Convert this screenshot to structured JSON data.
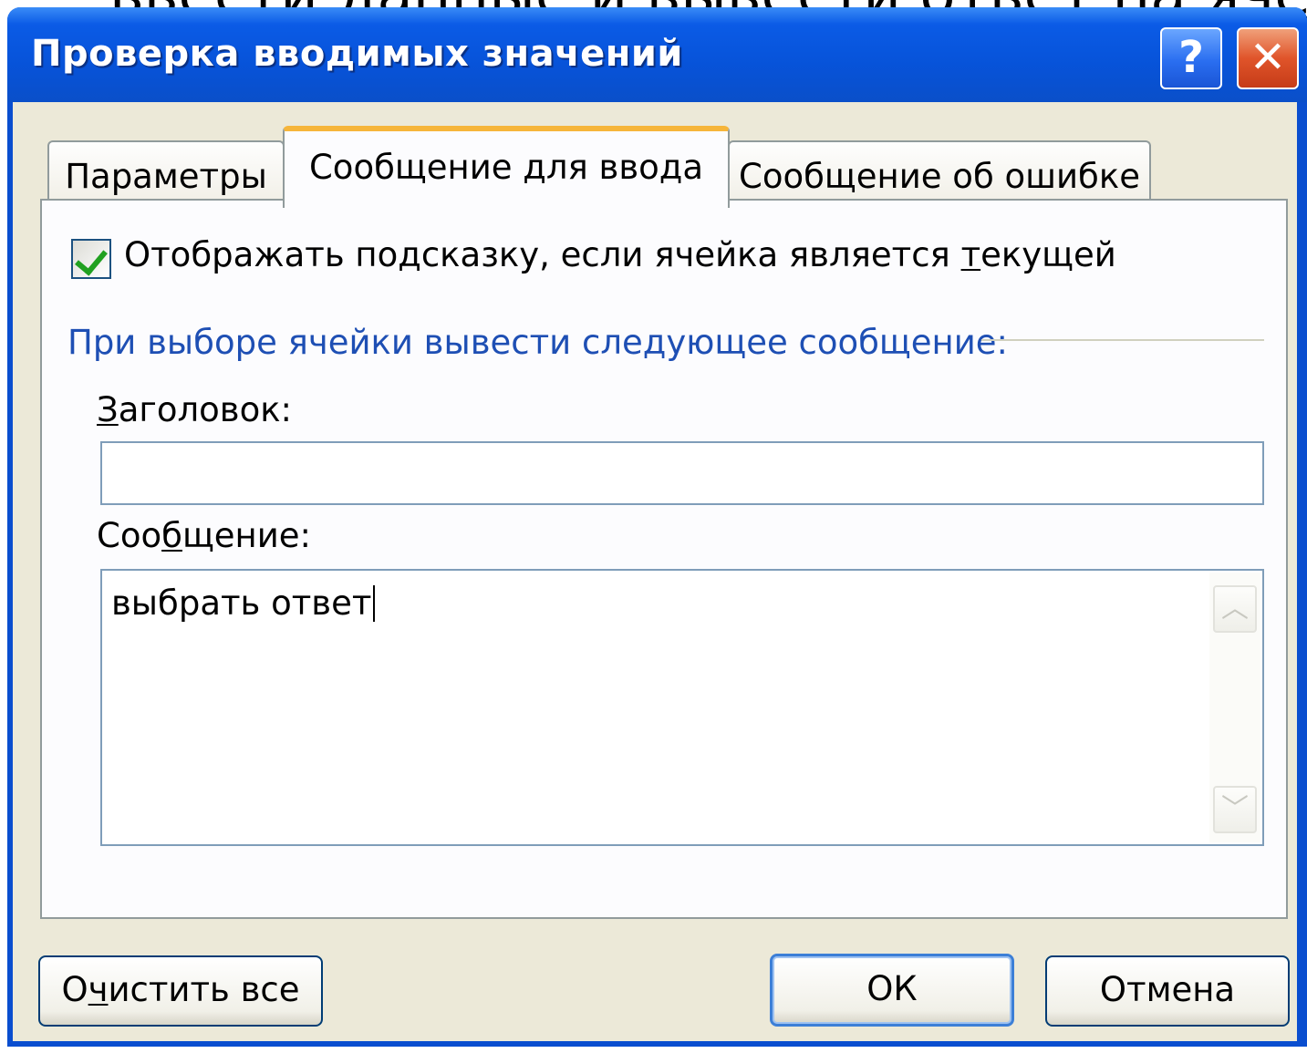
{
  "backdrop": {
    "text": "ввести данные и вывести ответ на ячейку"
  },
  "window": {
    "title": "Проверка вводимых значений",
    "help_glyph": "?",
    "close_glyph": "✕"
  },
  "tabs": [
    {
      "label": "Параметры",
      "active": false
    },
    {
      "label": "Сообщение для ввода",
      "active": true
    },
    {
      "label": "Сообщение об ошибке",
      "active": false
    }
  ],
  "panel": {
    "show_hint": {
      "checked": true,
      "label_pre": "Отображать подсказку, если ячейка является ",
      "label_accel": "т",
      "label_post": "екущей"
    },
    "group_label": "При выборе ячейки вывести следующее сообщение:",
    "title_field": {
      "label_accel": "З",
      "label_rest": "аголовок:",
      "value": ""
    },
    "message_field": {
      "label_pre": "Соо",
      "label_accel": "б",
      "label_post": "щение:",
      "value": "выбрать ответ"
    }
  },
  "buttons": {
    "clear": {
      "pre": "О",
      "accel": "ч",
      "post": "истить все"
    },
    "ok": "ОК",
    "cancel": "Отмена"
  },
  "icons": {
    "scroll_up": "chevron-up-icon",
    "scroll_down": "chevron-down-icon"
  },
  "colors": {
    "titlebar": "#0753d9",
    "active_tab_accent": "#f6b53a",
    "group_label": "#1e4fb4",
    "client_bg": "#ece9d8"
  }
}
